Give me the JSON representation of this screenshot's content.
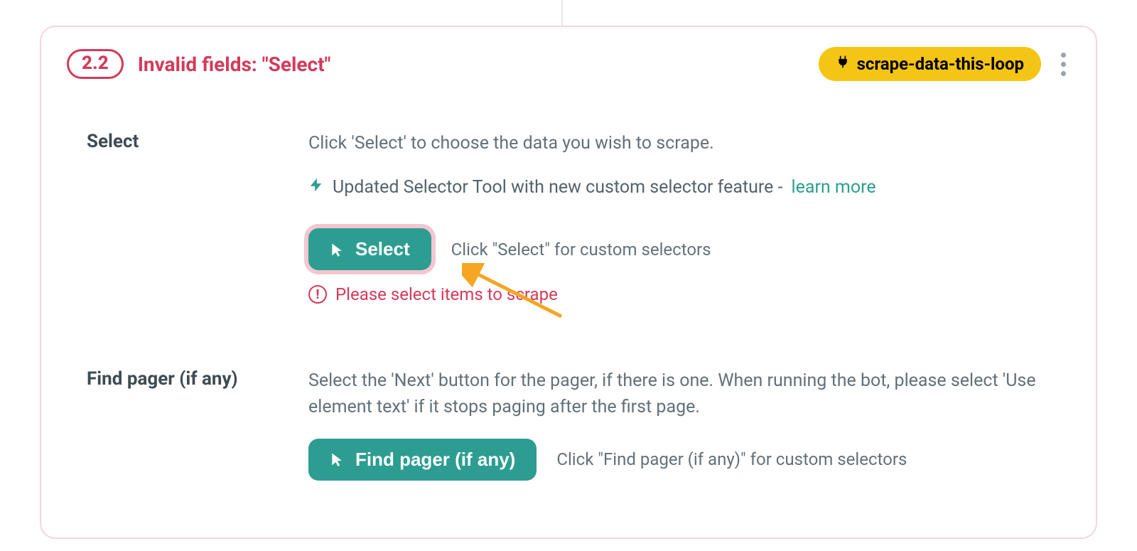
{
  "card": {
    "step_number": "2.2",
    "title": "Invalid fields: \"Select\"",
    "tag_label": "scrape-data-this-loop"
  },
  "fields": {
    "select": {
      "label": "Select",
      "description": "Click 'Select' to choose the data you wish to scrape.",
      "info_text": "Updated Selector Tool with new custom selector feature -",
      "learn_more": "learn more",
      "button_label": "Select",
      "hint": "Click \"Select\" for custom selectors",
      "error": "Please select items to scrape"
    },
    "pager": {
      "label": "Find pager (if any)",
      "description": "Select the 'Next' button for the pager, if there is one. When running the bot, please select 'Use element text' if it stops paging after the first page.",
      "button_label": "Find pager (if any)",
      "hint": "Click \"Find pager (if any)\" for custom selectors"
    }
  }
}
